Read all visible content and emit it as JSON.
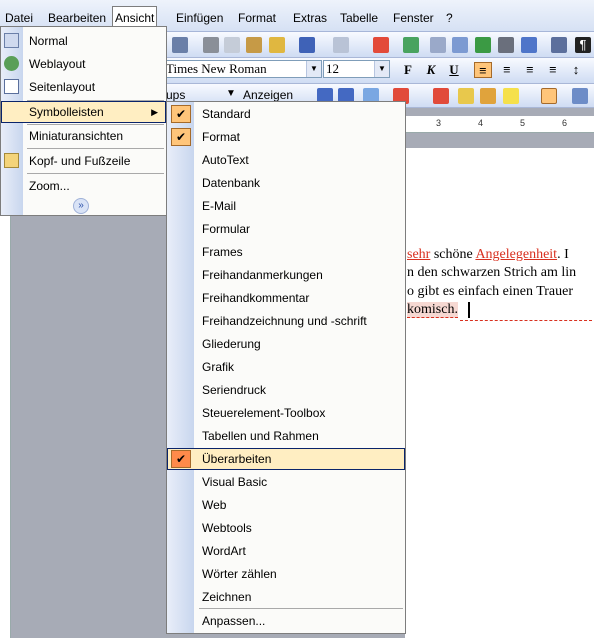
{
  "menubar": [
    "Datei",
    "Bearbeiten",
    "Ansicht",
    "Einfügen",
    "Format",
    "Extras",
    "Tabelle",
    "Fenster",
    "?"
  ],
  "toolbar": {
    "font_name": "Times New Roman",
    "font_size": "12",
    "style_partial": "ups",
    "show_label": "Anzeigen"
  },
  "ruler_labels": [
    "3",
    "4",
    "5",
    "6"
  ],
  "document": {
    "line1": {
      "word1": "sehr",
      "normal": " schöne ",
      "word2": "Angelegenheit",
      "end": ". I"
    },
    "line2": "n den schwarzen Strich am lin",
    "line3": "o gibt es einfach einen Trauer",
    "line4": "komisch."
  },
  "ansicht_menu": {
    "normal": "Normal",
    "weblayout": "Weblayout",
    "seitenlayout": "Seitenlayout",
    "symbolleisten": "Symbolleisten",
    "miniatur": "Miniaturansichten",
    "kopf": "Kopf- und Fußzeile",
    "zoom": "Zoom..."
  },
  "symbolleisten_menu": {
    "items": [
      "Standard",
      "Format",
      "AutoText",
      "Datenbank",
      "E-Mail",
      "Formular",
      "Frames",
      "Freihandanmerkungen",
      "Freihandkommentar",
      "Freihandzeichnung und -schrift",
      "Gliederung",
      "Grafik",
      "Seriendruck",
      "Steuerelement-Toolbox",
      "Tabellen und Rahmen",
      "Überarbeiten",
      "Visual Basic",
      "Web",
      "Webtools",
      "WordArt",
      "Wörter zählen",
      "Zeichnen"
    ],
    "checked": [
      "Standard",
      "Format",
      "Überarbeiten"
    ],
    "highlighted": "Überarbeiten",
    "customize": "Anpassen..."
  },
  "colors": {
    "highlight": "#ffeec2",
    "check_bg": "#ffc57a",
    "accent_red": "#d8301f"
  }
}
